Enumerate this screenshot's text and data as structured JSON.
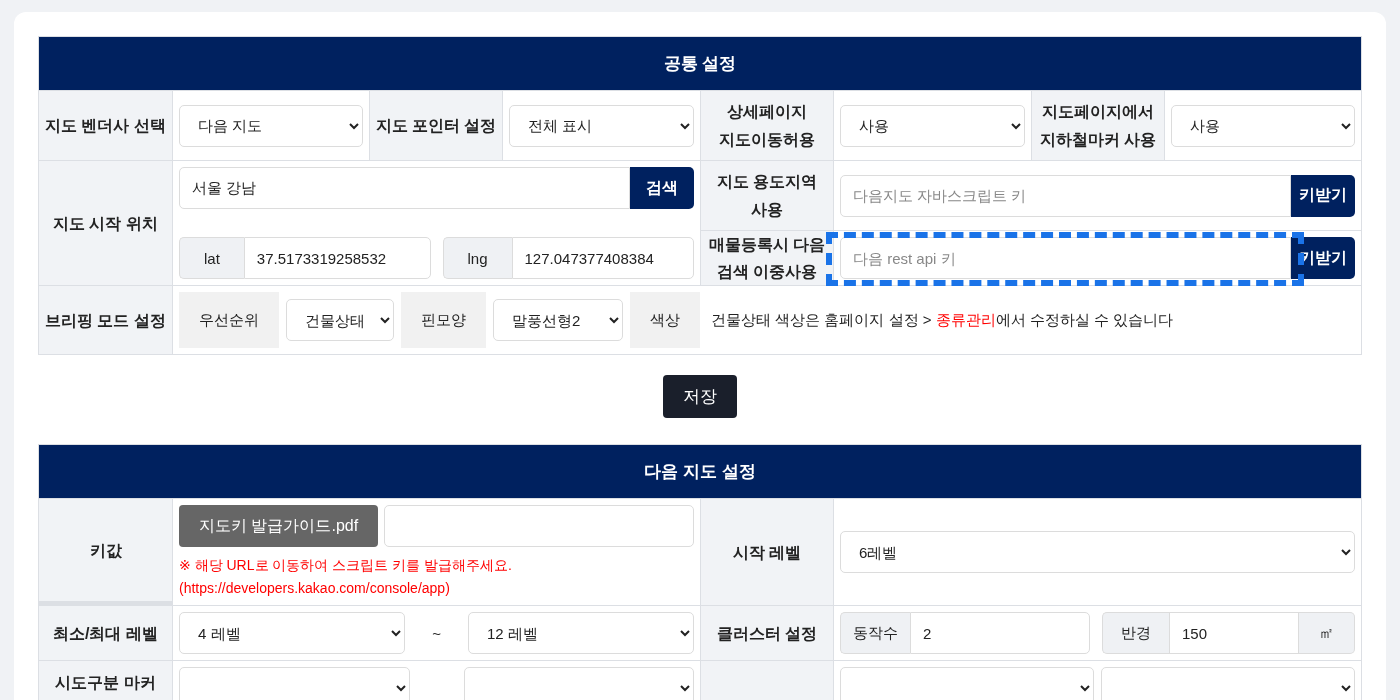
{
  "common_settings": {
    "title": "공통 설정",
    "vendor": {
      "label": "지도 벤더사 선택",
      "value": "다음 지도"
    },
    "pointer": {
      "label": "지도 포인터 설정",
      "value": "전체 표시"
    },
    "detail_move": {
      "label": "상세페이지\n지도이동허용",
      "value": "사용"
    },
    "subway_marker": {
      "label": "지도페이지에서\n지하철마커 사용",
      "value": "사용"
    },
    "start_location": {
      "label": "지도 시작 위치",
      "search_value": "서울 강남",
      "search_button": "검색",
      "lat": {
        "label": "lat",
        "value": "37.5173319258532"
      },
      "lng": {
        "label": "lng",
        "value": "127.047377408384"
      }
    },
    "zoning": {
      "label": "지도 용도지역\n사용",
      "placeholder": "다음지도 자바스크립트 키",
      "button": "키받기"
    },
    "rest_api": {
      "label": "매물등록시 다음\n검색 이중사용",
      "placeholder": "다음 rest api 키",
      "button": "키받기",
      "highlighted": true
    },
    "briefing": {
      "label": "브리핑 모드 설정",
      "priority": {
        "label": "우선순위",
        "value": "건물상태"
      },
      "pin": {
        "label": "핀모양",
        "value": "말풍선형2"
      },
      "color": {
        "label": "색상"
      },
      "note_before": "건물상태 색상은 홈페이지 설정 > ",
      "note_link": "종류관리",
      "note_after": "에서 수정하실 수 있습니다"
    }
  },
  "save_button": "저장",
  "daum_settings": {
    "title": "다음 지도 설정",
    "key": {
      "label": "키값",
      "guide_button": "지도키 발급가이드.pdf",
      "notes": [
        "※ 해당 URL로 이동하여 스크립트 키를 발급해주세요.",
        "(https://developers.kakao.com/console/app)"
      ]
    },
    "start_level": {
      "label": "시작 레벨",
      "value": "6레벨"
    },
    "min_max": {
      "label": "최소/최대 레벨",
      "min": "4 레벨",
      "separator": "~",
      "max": "12 레벨"
    },
    "cluster": {
      "label": "클러스터 설정",
      "count": {
        "label": "동작수",
        "value": "2"
      },
      "radius": {
        "label": "반경",
        "value": "150",
        "unit": "㎡"
      }
    },
    "sido_marker": {
      "label": "시도구분 마커"
    }
  }
}
